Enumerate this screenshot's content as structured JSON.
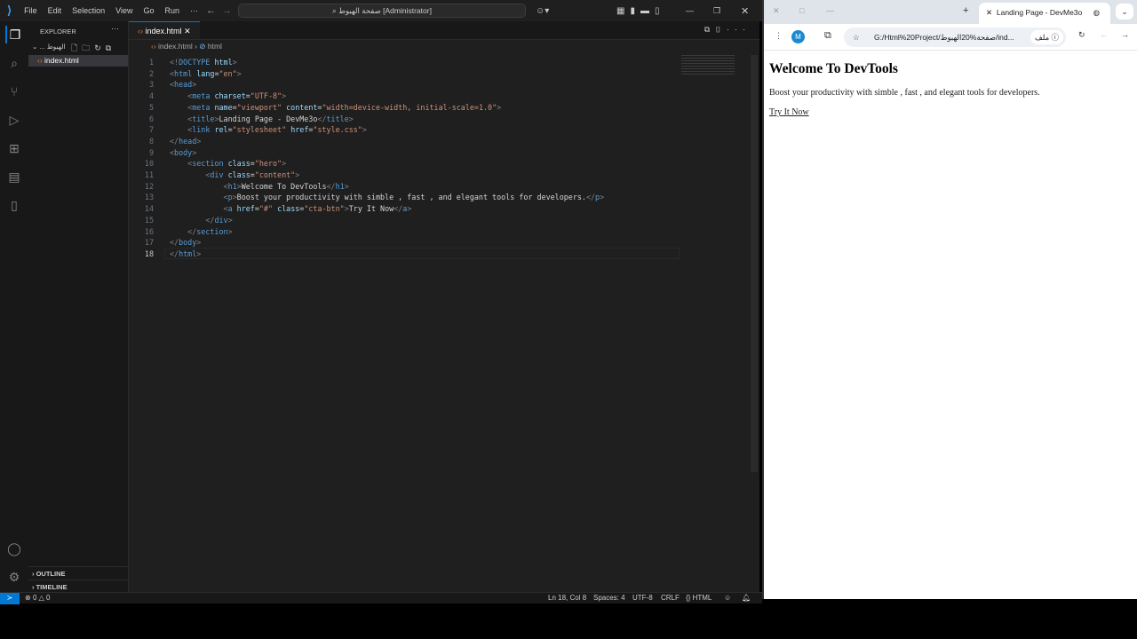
{
  "titlebar": {
    "menus": [
      "File",
      "Edit",
      "Selection",
      "View",
      "Go",
      "Run",
      "···"
    ],
    "command_center": "صفحة الهبوط [Administrator]"
  },
  "sidebar": {
    "title": "EXPLORER",
    "folder": "... الهبوط",
    "file": "index.html",
    "outline": "OUTLINE",
    "timeline": "TIMELINE"
  },
  "editor": {
    "tab": "index.html",
    "breadcrumb_file": "index.html",
    "breadcrumb_symbol": "html",
    "lines": [
      [
        0,
        [
          [
            "p",
            "<!"
          ],
          [
            "t",
            "DOCTYPE"
          ],
          [
            "x",
            " "
          ],
          [
            "a",
            "html"
          ],
          [
            "p",
            ">"
          ]
        ]
      ],
      [
        0,
        [
          [
            "p",
            "<"
          ],
          [
            "t",
            "html"
          ],
          [
            "x",
            " "
          ],
          [
            "a",
            "lang"
          ],
          [
            "x",
            "="
          ],
          [
            "s",
            "\"en\""
          ],
          [
            "p",
            ">"
          ]
        ]
      ],
      [
        0,
        [
          [
            "p",
            "<"
          ],
          [
            "t",
            "head"
          ],
          [
            "p",
            ">"
          ]
        ]
      ],
      [
        1,
        [
          [
            "p",
            "<"
          ],
          [
            "t",
            "meta"
          ],
          [
            "x",
            " "
          ],
          [
            "a",
            "charset"
          ],
          [
            "x",
            "="
          ],
          [
            "s",
            "\"UTF-8\""
          ],
          [
            "p",
            ">"
          ]
        ]
      ],
      [
        1,
        [
          [
            "p",
            "<"
          ],
          [
            "t",
            "meta"
          ],
          [
            "x",
            " "
          ],
          [
            "a",
            "name"
          ],
          [
            "x",
            "="
          ],
          [
            "s",
            "\"viewport\""
          ],
          [
            "x",
            " "
          ],
          [
            "a",
            "content"
          ],
          [
            "x",
            "="
          ],
          [
            "s",
            "\"width=device-width, initial-scale=1.0\""
          ],
          [
            "p",
            ">"
          ]
        ]
      ],
      [
        1,
        [
          [
            "p",
            "<"
          ],
          [
            "t",
            "title"
          ],
          [
            "p",
            ">"
          ],
          [
            "x",
            "Landing Page - DevMe3o"
          ],
          [
            "p",
            "</"
          ],
          [
            "t",
            "title"
          ],
          [
            "p",
            ">"
          ]
        ]
      ],
      [
        1,
        [
          [
            "p",
            "<"
          ],
          [
            "t",
            "link"
          ],
          [
            "x",
            " "
          ],
          [
            "a",
            "rel"
          ],
          [
            "x",
            "="
          ],
          [
            "s",
            "\"stylesheet\""
          ],
          [
            "x",
            " "
          ],
          [
            "a",
            "href"
          ],
          [
            "x",
            "="
          ],
          [
            "s",
            "\"style.css\""
          ],
          [
            "p",
            ">"
          ]
        ]
      ],
      [
        0,
        [
          [
            "p",
            "</"
          ],
          [
            "t",
            "head"
          ],
          [
            "p",
            ">"
          ]
        ]
      ],
      [
        0,
        [
          [
            "p",
            "<"
          ],
          [
            "t",
            "body"
          ],
          [
            "p",
            ">"
          ]
        ]
      ],
      [
        1,
        [
          [
            "p",
            "<"
          ],
          [
            "t",
            "section"
          ],
          [
            "x",
            " "
          ],
          [
            "a",
            "class"
          ],
          [
            "x",
            "="
          ],
          [
            "s",
            "\"hero\""
          ],
          [
            "p",
            ">"
          ]
        ]
      ],
      [
        2,
        [
          [
            "p",
            "<"
          ],
          [
            "t",
            "div"
          ],
          [
            "x",
            " "
          ],
          [
            "a",
            "class"
          ],
          [
            "x",
            "="
          ],
          [
            "s",
            "\"content\""
          ],
          [
            "p",
            ">"
          ]
        ]
      ],
      [
        3,
        [
          [
            "p",
            "<"
          ],
          [
            "t",
            "h1"
          ],
          [
            "p",
            ">"
          ],
          [
            "x",
            "Welcome To DevTools"
          ],
          [
            "p",
            "</"
          ],
          [
            "t",
            "h1"
          ],
          [
            "p",
            ">"
          ]
        ]
      ],
      [
        3,
        [
          [
            "p",
            "<"
          ],
          [
            "t",
            "p"
          ],
          [
            "p",
            ">"
          ],
          [
            "x",
            "Boost your productivity with simble , fast , and elegant tools for developers."
          ],
          [
            "p",
            "</"
          ],
          [
            "t",
            "p"
          ],
          [
            "p",
            ">"
          ]
        ]
      ],
      [
        3,
        [
          [
            "p",
            "<"
          ],
          [
            "t",
            "a"
          ],
          [
            "x",
            " "
          ],
          [
            "a",
            "href"
          ],
          [
            "x",
            "="
          ],
          [
            "s",
            "\"#\""
          ],
          [
            "x",
            " "
          ],
          [
            "a",
            "class"
          ],
          [
            "x",
            "="
          ],
          [
            "s",
            "\"cta-btn\""
          ],
          [
            "p",
            ">"
          ],
          [
            "x",
            "Try It Now"
          ],
          [
            "p",
            "</"
          ],
          [
            "t",
            "a"
          ],
          [
            "p",
            ">"
          ]
        ]
      ],
      [
        2,
        [
          [
            "p",
            "</"
          ],
          [
            "t",
            "div"
          ],
          [
            "p",
            ">"
          ]
        ]
      ],
      [
        1,
        [
          [
            "p",
            "</"
          ],
          [
            "t",
            "section"
          ],
          [
            "p",
            ">"
          ]
        ]
      ],
      [
        0,
        [
          [
            "p",
            "</"
          ],
          [
            "t",
            "body"
          ],
          [
            "p",
            ">"
          ]
        ]
      ],
      [
        0,
        [
          [
            "p",
            "</"
          ],
          [
            "t",
            "html"
          ],
          [
            "p",
            ">"
          ]
        ]
      ]
    ]
  },
  "status": {
    "errors": "0",
    "warnings": "0",
    "position": "Ln 18, Col 8",
    "spaces": "Spaces: 4",
    "encoding": "UTF-8",
    "eol": "CRLF",
    "language": "HTML"
  },
  "browser": {
    "tab_title": "Landing Page - DevMe3o",
    "profile": "M",
    "url": "G:/Html%20Project/صفحة%20الهبوط/ind...",
    "site_info": "ملف",
    "page": {
      "heading": "Welcome To DevTools",
      "paragraph": "Boost your productivity with simble , fast , and elegant tools for developers.",
      "link": "Try It Now"
    }
  }
}
